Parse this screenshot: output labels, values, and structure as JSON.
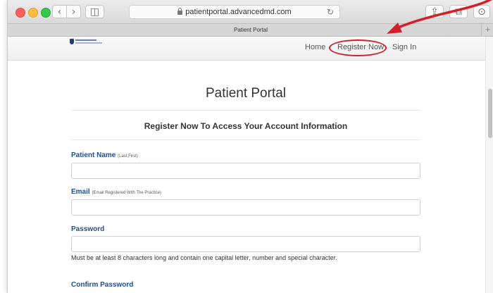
{
  "browser": {
    "url": "patientportal.advancedmd.com",
    "tab_title": "Patient Portal",
    "back_icon": "‹",
    "forward_icon": "›",
    "sidebar_icon": "◫",
    "reload_icon": "↻",
    "share_icon": "⇪",
    "tabs_icon": "⧉",
    "downloads_icon": "⊙",
    "new_tab_icon": "+"
  },
  "nav": {
    "home": "Home",
    "register": "Register Now",
    "signin": "Sign In"
  },
  "page": {
    "title": "Patient Portal",
    "subtitle": "Register Now To Access Your Account Information"
  },
  "form": {
    "patient_name": {
      "label": "Patient Name",
      "hint": "(Last,First)"
    },
    "email": {
      "label": "Email",
      "hint": "(Email Registered With The Practice)"
    },
    "password": {
      "label": "Password",
      "help": "Must be at least 8 characters long and contain one capital letter, number and special character."
    },
    "confirm_password": {
      "label": "Confirm Password"
    }
  },
  "colors": {
    "accent": "#1f4e8c",
    "annotation": "#d0202a"
  }
}
